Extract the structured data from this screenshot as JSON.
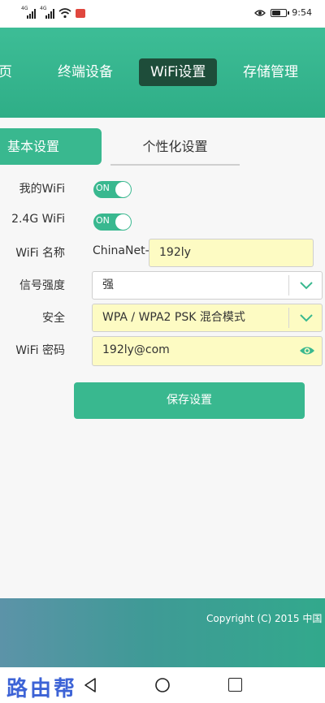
{
  "statusbar": {
    "sim1_label": "4G",
    "sim2_label": "4G",
    "time": "9:54",
    "battery_percent": 60,
    "accent_badge_color": "#e0473e"
  },
  "nav": {
    "items": [
      "页",
      "终端设备",
      "WiFi设置",
      "存储管理"
    ],
    "active_index": 2,
    "header_color": "#36b58e",
    "active_color": "#1e4d3a"
  },
  "subtabs": {
    "basic": "基本设置",
    "personalized": "个性化设置"
  },
  "form": {
    "my_wifi": {
      "label": "我的WiFi",
      "toggle": "ON"
    },
    "wifi_24g": {
      "label": "2.4G WiFi",
      "toggle": "ON"
    },
    "wifi_name": {
      "label": "WiFi 名称",
      "prefix": "ChinaNet-",
      "value": "192ly"
    },
    "signal": {
      "label": "信号强度",
      "value": "强",
      "icon": "chevron-down-icon"
    },
    "security": {
      "label": "安全",
      "value": "WPA / WPA2 PSK 混合模式",
      "icon": "chevron-down-icon"
    },
    "password": {
      "label": "WiFi 密码",
      "value": "192ly@com",
      "icon": "eye-icon"
    }
  },
  "actions": {
    "save": "保存设置"
  },
  "footer": {
    "copyright": "Copyright (C) 2015 中国"
  },
  "watermark": {
    "text": "路由帮",
    "color": "#3d63d6"
  }
}
